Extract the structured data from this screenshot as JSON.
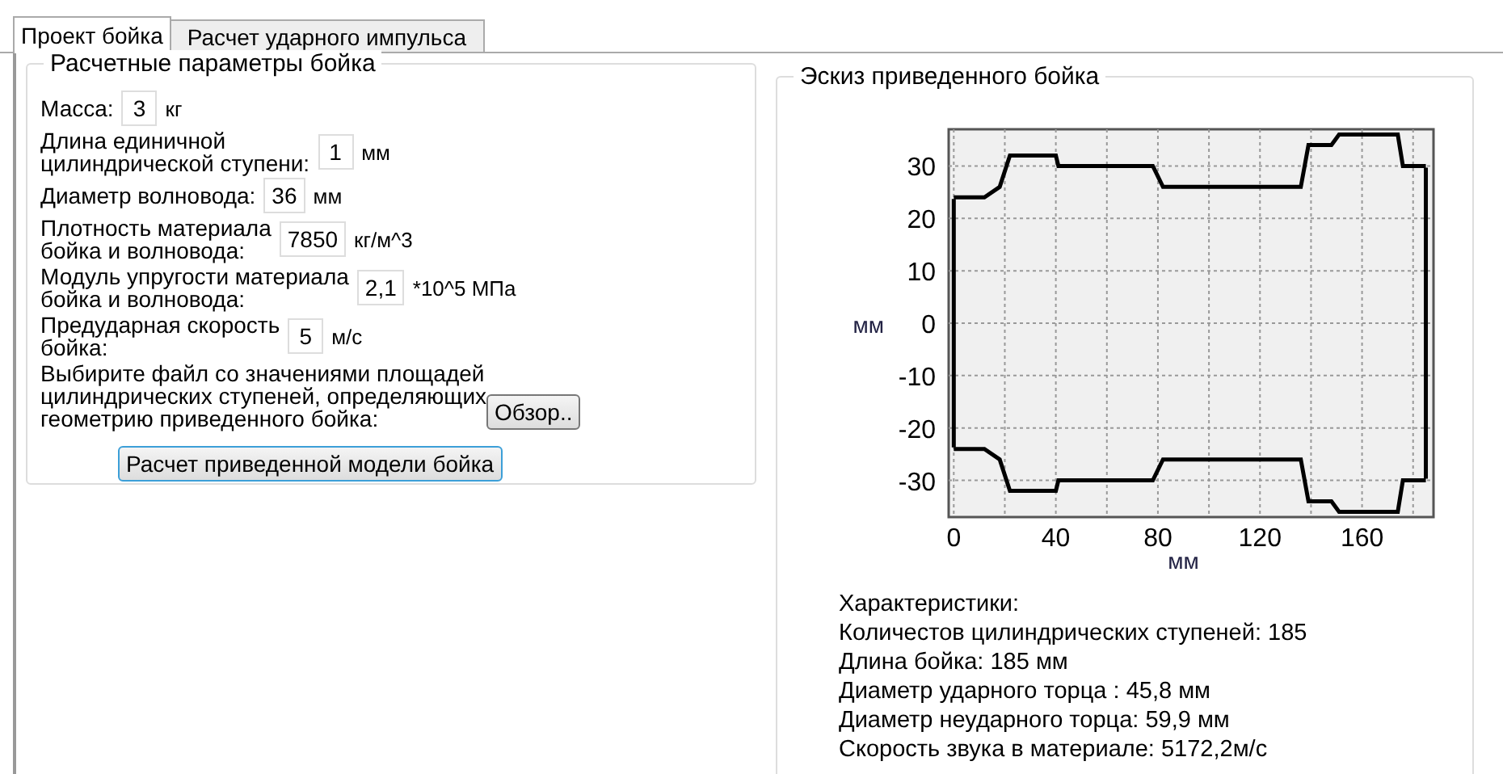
{
  "tabs": [
    {
      "label": "Проект бойка",
      "selected": true
    },
    {
      "label": "Расчет ударного импульса",
      "selected": false
    }
  ],
  "params": {
    "title": "Расчетные параметры бойка",
    "fields": [
      {
        "label": "Масса:",
        "value": "3",
        "unit": "кг"
      },
      {
        "label": "Длина единичной\nцилиндрической ступени:",
        "value": "1",
        "unit": "мм"
      },
      {
        "label": "Диаметр волновода:",
        "value": "36",
        "unit": "мм"
      },
      {
        "label": "Плотность материала\nбойка и волновода:",
        "value": "7850",
        "unit": "кг/м^3"
      },
      {
        "label": "Модуль упругости материала\nбойка и волновода:",
        "value": "2,1",
        "unit": "*10^5 МПа"
      },
      {
        "label": "Предударная скорость\nбойка:",
        "value": "5",
        "unit": "м/с"
      }
    ],
    "file_prompt": "Выбирите файл со значениями площадей\nцилиндрических ступеней, определяющих\nгеометрию приведенного бойка:",
    "browse_button": "Обзор..",
    "calc_button": "Расчет приведенной модели бойка"
  },
  "sketch": {
    "title": "Эскиз приведенного бойка",
    "chart_data": {
      "type": "line",
      "xlabel": "мм",
      "ylabel": "мм",
      "x": [
        0,
        12,
        18,
        22,
        40,
        41,
        78,
        82,
        136,
        139,
        148,
        151,
        174,
        176,
        185
      ],
      "series": [
        {
          "color": "#000000",
          "values": [
            24,
            24,
            26,
            32,
            32,
            30,
            30,
            26,
            26,
            34,
            34,
            36,
            36,
            30,
            30
          ]
        },
        {
          "color": "#000000",
          "values": [
            -24,
            -24,
            -26,
            -32,
            -32,
            -30,
            -30,
            -26,
            -26,
            -34,
            -34,
            -36,
            -36,
            -30,
            -30
          ]
        }
      ],
      "grid": true,
      "ref_lines": [
        {
          "axis": "x",
          "value": 0
        },
        {
          "axis": "x",
          "value": 185
        }
      ],
      "xlim": [
        -2,
        188
      ],
      "ylim": [
        -37,
        37
      ],
      "xticks": [
        0,
        40,
        80,
        120,
        160
      ],
      "yticks": [
        -30,
        -20,
        -10,
        0,
        10,
        20,
        30
      ]
    }
  },
  "characteristics": {
    "title": "Характеристики:",
    "lines": [
      "Количестов цилиндрических ступеней: 185",
      "Длина бойка: 185 мм",
      "Диаметр ударного торца : 45,8 мм",
      "Диаметр неударного торца: 59,9 мм",
      "Скорость звука в материале: 5172,2м/с"
    ]
  }
}
